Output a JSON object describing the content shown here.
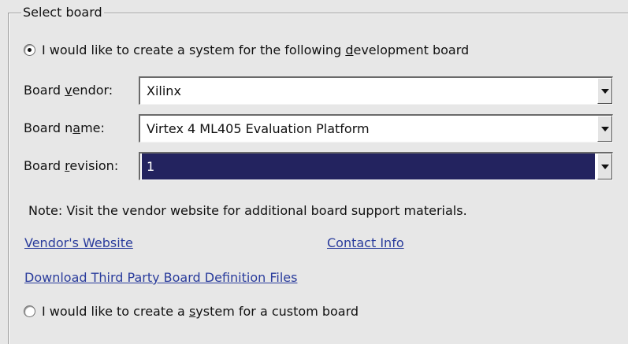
{
  "group": {
    "title": "Select board"
  },
  "dev_board_option": {
    "label_before": "I would like to create a system for the following ",
    "label_mnemonic": "d",
    "label_after": "evelopment board",
    "selected": true
  },
  "fields": {
    "vendor": {
      "label_before": "Board ",
      "label_mnemonic": "v",
      "label_after": "endor:",
      "value": "Xilinx"
    },
    "name": {
      "label_before": "Board n",
      "label_mnemonic": "a",
      "label_after": "me:",
      "value": "Virtex 4 ML405 Evaluation Platform"
    },
    "revision": {
      "label_before": "Board ",
      "label_mnemonic": "r",
      "label_after": "evision:",
      "value": "1"
    }
  },
  "note": "Note: Visit the vendor website for additional board support materials.",
  "links": {
    "vendor_website": "Vendor's Website",
    "contact_info": "Contact Info",
    "download": "Download Third Party Board Definition Files"
  },
  "custom_board_option": {
    "label_before": "I would like to create a ",
    "label_mnemonic": "s",
    "label_after": "ystem for a custom board",
    "selected": false
  }
}
